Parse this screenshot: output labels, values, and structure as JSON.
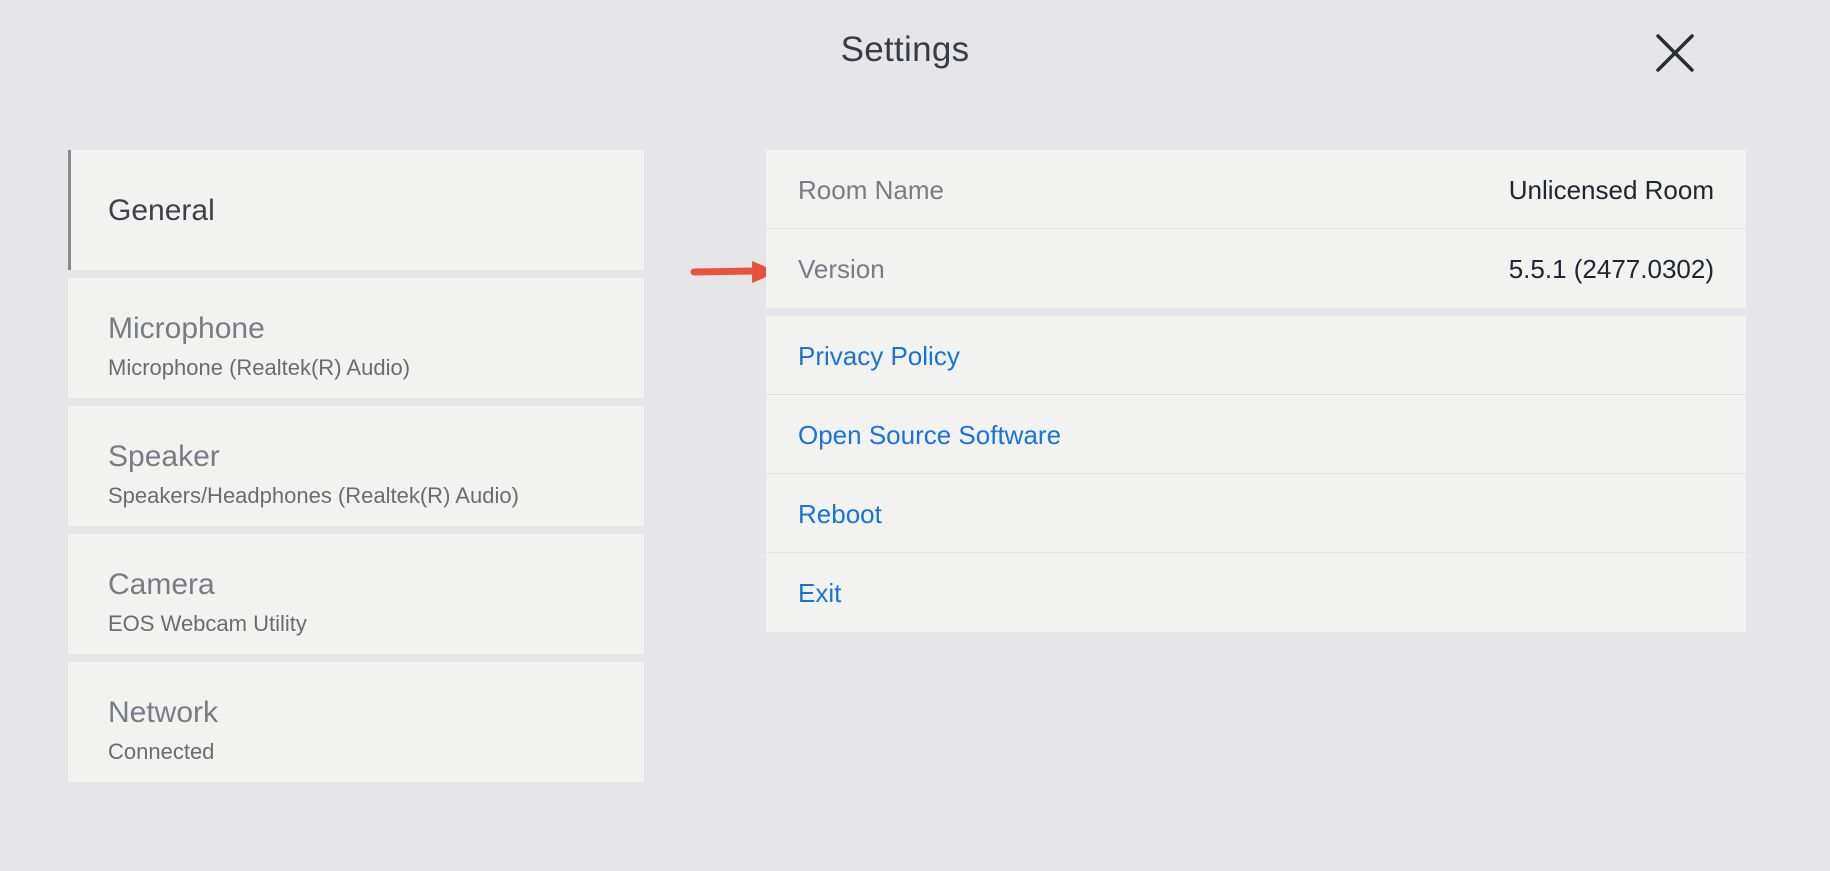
{
  "header": {
    "title": "Settings"
  },
  "icons": {
    "close": "close-icon",
    "annotation": "red-arrow-annotation-icon"
  },
  "colors": {
    "background": "#e6e6e8",
    "card": "#f2f2f1",
    "link": "#1a73d9",
    "annotation_arrow": "#e8533f",
    "active_indicator": "#8a8a90"
  },
  "sidebar": {
    "items": [
      {
        "title": "General",
        "subtitle": "",
        "active": true
      },
      {
        "title": "Microphone",
        "subtitle": "Microphone (Realtek(R) Audio)",
        "active": false
      },
      {
        "title": "Speaker",
        "subtitle": "Speakers/Headphones (Realtek(R) Audio)",
        "active": false
      },
      {
        "title": "Camera",
        "subtitle": "EOS Webcam Utility",
        "active": false
      },
      {
        "title": "Network",
        "subtitle": "Connected",
        "active": false
      }
    ]
  },
  "general": {
    "info": [
      {
        "label": "Room Name",
        "value": "Unlicensed Room"
      },
      {
        "label": "Version",
        "value": "5.5.1 (2477.0302)"
      }
    ],
    "links": [
      {
        "label": "Privacy Policy"
      },
      {
        "label": "Open Source Software"
      },
      {
        "label": "Reboot"
      },
      {
        "label": "Exit"
      }
    ]
  }
}
